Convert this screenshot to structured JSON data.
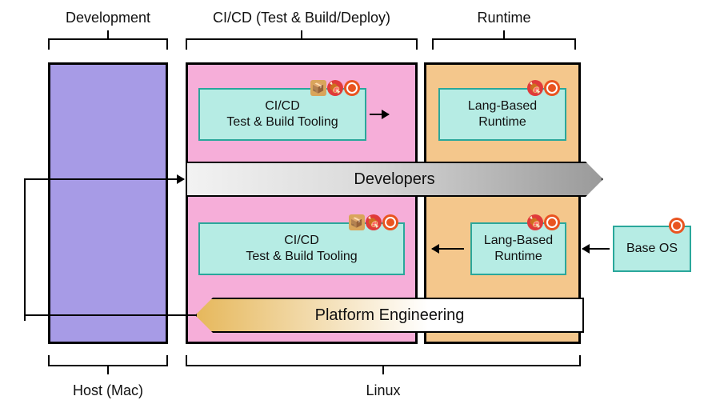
{
  "top_labels": {
    "development": "Development",
    "cicd": "CI/CD  (Test & Build/Deploy)",
    "runtime": "Runtime"
  },
  "bottom_labels": {
    "host": "Host (Mac)",
    "linux": "Linux"
  },
  "columns": {
    "dev": {
      "name": "development-column"
    },
    "cicd": {
      "name": "cicd-column"
    },
    "runtime": {
      "name": "runtime-column"
    }
  },
  "boxes": {
    "cicd_top": {
      "line1": "CI/CD",
      "line2": "Test & Build Tooling"
    },
    "runtime_top": {
      "line1": "Lang-Based",
      "line2": "Runtime"
    },
    "cicd_bottom": {
      "line1": "CI/CD",
      "line2": "Test & Build Tooling"
    },
    "runtime_bottom": {
      "line1": "Lang-Based",
      "line2": "Runtime"
    },
    "base_os": {
      "line1": "Base OS"
    }
  },
  "chevrons": {
    "developers": "Developers",
    "platform": "Platform Engineering"
  },
  "icons": {
    "box": "package-icon",
    "meat": "meat-icon",
    "ubuntu": "ubuntu-icon"
  },
  "colors": {
    "dev_col": "#a79be6",
    "cicd_col": "#f6aed9",
    "runtime_col": "#f4c78c",
    "box_bg": "#b6ece4",
    "box_border": "#2aa79b"
  },
  "chart_data": {
    "type": "diagram",
    "phases": [
      {
        "name": "Development",
        "host": "Host (Mac)"
      },
      {
        "name": "CI/CD (Test & Build/Deploy)",
        "host": "Linux"
      },
      {
        "name": "Runtime",
        "host": "Linux"
      }
    ],
    "flows": [
      {
        "actor": "Developers",
        "path": [
          "Development",
          "CI/CD Test & Build Tooling",
          "Lang-Based Runtime"
        ],
        "direction": "left-to-right"
      },
      {
        "actor": "Platform Engineering",
        "path": [
          "Base OS",
          "Lang-Based Runtime",
          "CI/CD Test & Build Tooling",
          "Development"
        ],
        "direction": "right-to-left"
      }
    ],
    "components": {
      "CI/CD Test & Build Tooling": {
        "icons": [
          "package",
          "meat",
          "ubuntu"
        ],
        "phase": "CI/CD"
      },
      "Lang-Based Runtime": {
        "icons": [
          "meat",
          "ubuntu"
        ],
        "phase": "Runtime"
      },
      "Base OS": {
        "icons": [
          "ubuntu"
        ],
        "phase": "external"
      }
    }
  }
}
